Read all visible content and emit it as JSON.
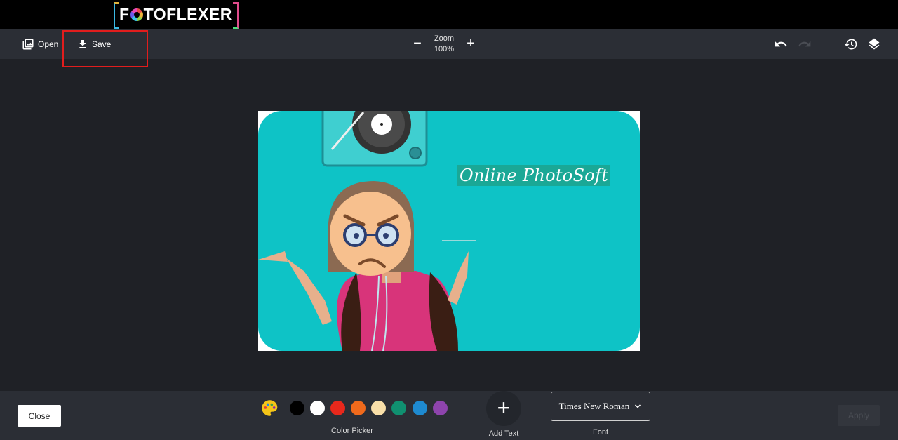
{
  "app": {
    "logo_text_1": "F",
    "logo_text_2": "TOFLEXER"
  },
  "toolbar": {
    "open_label": "Open",
    "save_label": "Save",
    "zoom_label": "Zoom",
    "zoom_value": "100%"
  },
  "canvas": {
    "overlay_text": "Online PhotoSoft"
  },
  "bottom": {
    "close_label": "Close",
    "color_picker_label": "Color Picker",
    "swatches": [
      "#000000",
      "#ffffff",
      "#e8281c",
      "#f06a1c",
      "#f9dfa9",
      "#109070",
      "#1e8ad0",
      "#8e44ad"
    ],
    "add_text_label": "Add Text",
    "font_value": "Times New Roman",
    "font_label": "Font",
    "apply_label": "Apply"
  },
  "colors": {
    "highlight": "#e11d1d",
    "canvas_bg": "#0ec3c6",
    "toolbar_bg": "#2b2e35",
    "page_bg": "#1f2126"
  }
}
